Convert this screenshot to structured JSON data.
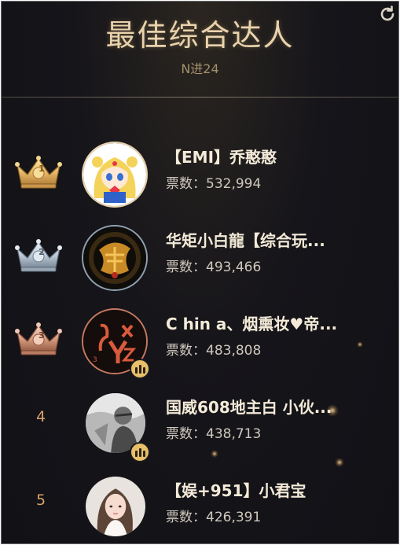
{
  "header": {
    "title": "最佳综合达人",
    "subtitle": "N进24"
  },
  "colors": {
    "gold": "#e6b766",
    "silver": "#b9c6d3",
    "bronze": "#d49a7f",
    "title": "#e9d3ad",
    "background": "#111116"
  },
  "ranking": [
    {
      "rank": "1",
      "name": "【EMI】乔憨憨",
      "votes_label": "票数：",
      "votes": "532,994",
      "badge": "gold-crown-icon",
      "live": false
    },
    {
      "rank": "2",
      "name": "华矩小白龍【综合玩...",
      "votes_label": "票数：",
      "votes": "493,466",
      "badge": "silver-crown-icon",
      "live": false
    },
    {
      "rank": "3",
      "name": "C hin a、烟熏妆♥帝...",
      "votes_label": "票数：",
      "votes": "483,808",
      "badge": "bronze-crown-icon",
      "live": true
    },
    {
      "rank": "4",
      "name": "国威608地主白 小伙...",
      "votes_label": "票数：",
      "votes": "438,713",
      "badge": null,
      "live": true
    },
    {
      "rank": "5",
      "name": "【娱+951】小君宝",
      "votes_label": "票数：",
      "votes": "426,391",
      "badge": null,
      "live": false
    }
  ]
}
